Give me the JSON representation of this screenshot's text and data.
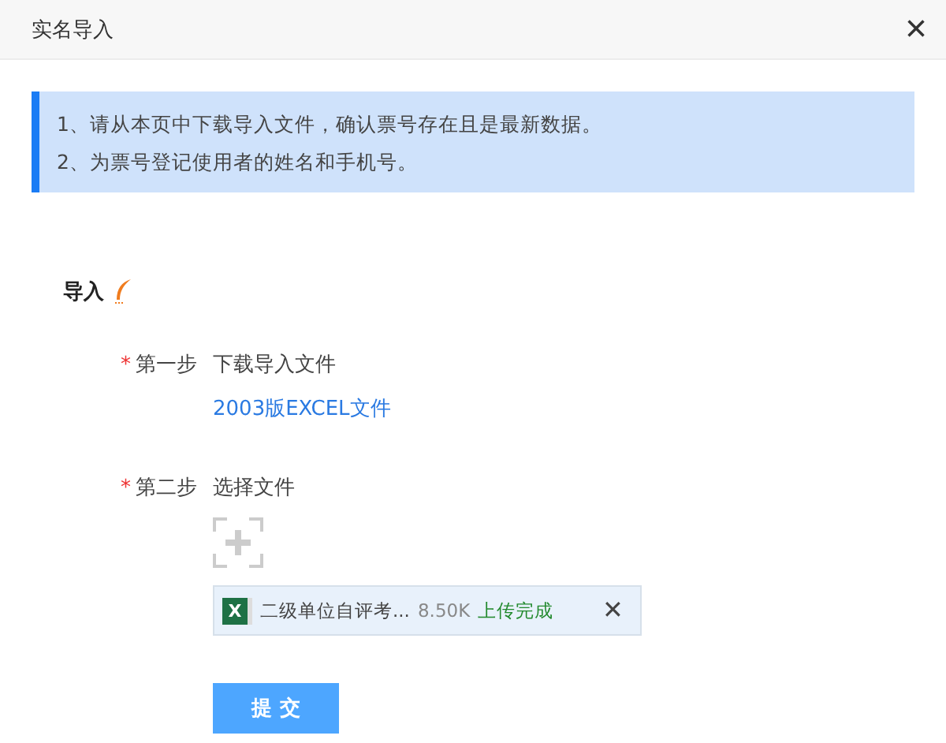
{
  "window": {
    "title": "实名导入",
    "close": "×"
  },
  "notice": {
    "lines": [
      "1、请从本页中下载导入文件，确认票号存在且是最新数据。",
      "2、为票号登记使用者的姓名和手机号。"
    ]
  },
  "section": {
    "title": "导入"
  },
  "steps": [
    {
      "required_mark": "*",
      "label": "第一步",
      "value": "下载导入文件",
      "link": "2003版EXCEL文件"
    },
    {
      "required_mark": "*",
      "label": "第二步",
      "value": "选择文件"
    }
  ],
  "file": {
    "icon_letter": "X",
    "name": "二级单位自评考...",
    "size": "8.50K",
    "status": "上传完成",
    "remove": "✕"
  },
  "submit": "提 交"
}
